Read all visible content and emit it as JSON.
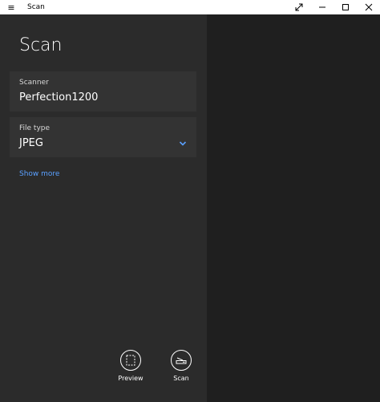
{
  "window": {
    "title": "Scan",
    "menu_icon": "hamburger-icon",
    "controls": [
      "expand-icon",
      "minimize-icon",
      "maximize-icon",
      "close-icon"
    ]
  },
  "panel": {
    "title": "Scan",
    "scanner": {
      "label": "Scanner",
      "value": "Perfection1200"
    },
    "file_type": {
      "label": "File type",
      "value": "JPEG",
      "icon": "chevron-down-icon"
    },
    "show_more": "Show more"
  },
  "actions": {
    "preview_label": "Preview",
    "scan_label": "Scan"
  },
  "colors": {
    "accent": "#5aa0ff",
    "pane_left": "#2b2b2b",
    "pane_right": "#1f1f1f",
    "field_bg": "#333333"
  }
}
